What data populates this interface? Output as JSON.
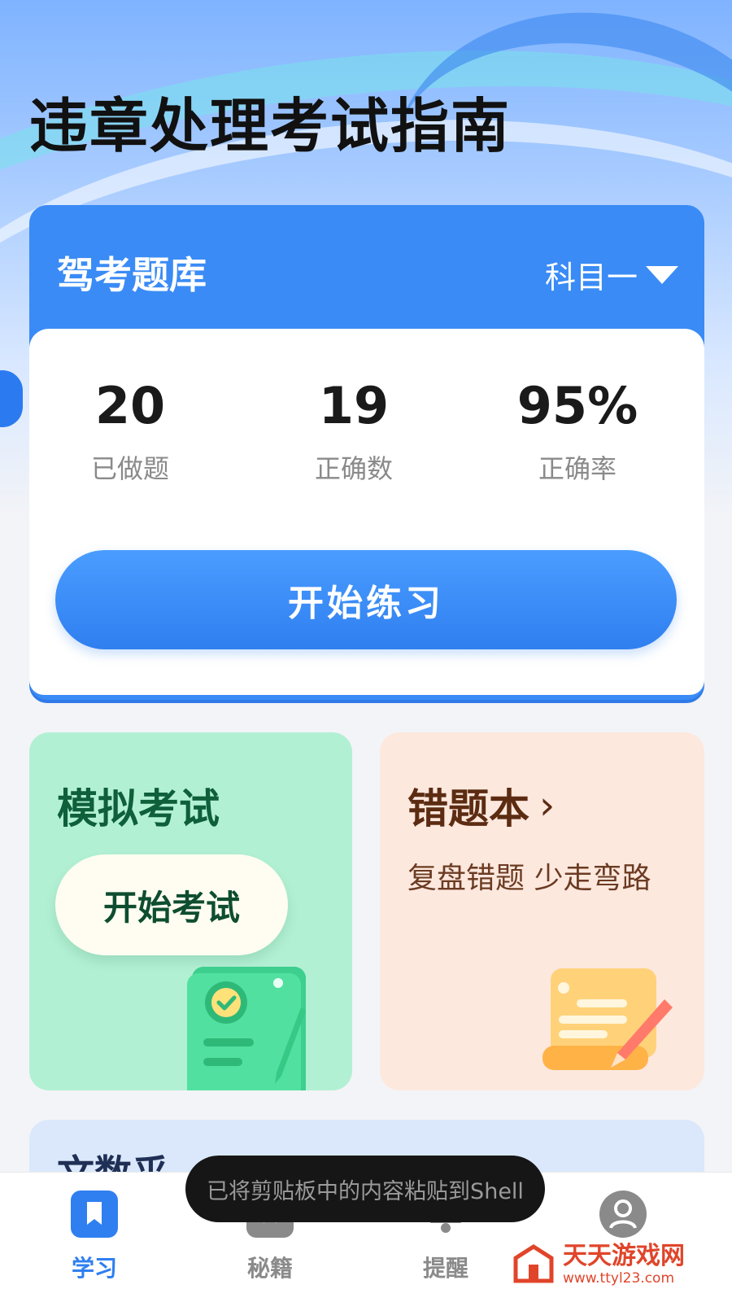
{
  "page": {
    "title": "违章处理考试指南"
  },
  "bank": {
    "title": "驾考题库",
    "subject": "科目一",
    "stats": [
      {
        "value": "20",
        "label": "已做题"
      },
      {
        "value": "19",
        "label": "正确数"
      },
      {
        "value": "95%",
        "label": "正确率"
      }
    ],
    "start_label": "开始练习"
  },
  "exam": {
    "title": "模拟考试",
    "button_label": "开始考试"
  },
  "wrong": {
    "title": "错题本",
    "chevron": "›",
    "subtitle": "复盘错题 少走弯路"
  },
  "peek": {
    "title": "文数乎"
  },
  "nav": {
    "items": [
      {
        "label": "学习",
        "icon": "bookmark-icon",
        "active": true
      },
      {
        "label": "秘籍",
        "icon": "star-book-icon",
        "active": false
      },
      {
        "label": "提醒",
        "icon": "bell-icon",
        "active": false
      },
      {
        "label": "",
        "icon": "user-icon",
        "active": false
      }
    ]
  },
  "toast": {
    "text": "已将剪贴板中的内容粘贴到Shell"
  },
  "watermark": {
    "name": "天天游戏网",
    "url": "www.ttyl23.com"
  },
  "colors": {
    "accent": "#3a8bf5",
    "exam_bg": "#b2f0d4",
    "wrong_bg": "#fde8de",
    "nav_active": "#2f7ff0",
    "nav_inactive": "#8a8a8a"
  }
}
